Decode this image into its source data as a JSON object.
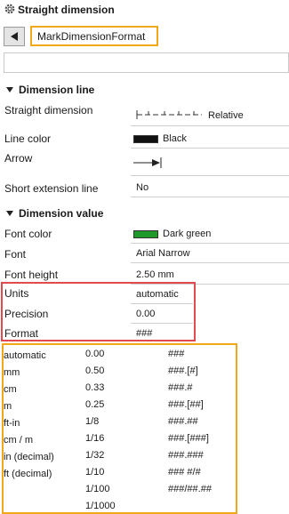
{
  "header": {
    "title": "Straight dimension",
    "format_field_value": "MarkDimensionFormat"
  },
  "sections": {
    "dimension_line": "Dimension line",
    "dimension_value": "Dimension value"
  },
  "properties": {
    "straight_dimension": {
      "label": "Straight dimension",
      "value": "Relative"
    },
    "line_color": {
      "label": "Line color",
      "value": "Black",
      "color": "#111111"
    },
    "arrow": {
      "label": "Arrow"
    },
    "short_extension_line": {
      "label": "Short extension line",
      "value": "No"
    },
    "font_color": {
      "label": "Font color",
      "value": "Dark green",
      "color": "#1f9a2a"
    },
    "font": {
      "label": "Font",
      "value": "Arial Narrow"
    },
    "font_height": {
      "label": "Font height",
      "value": "2.50 mm"
    },
    "units": {
      "label": "Units",
      "value": "automatic"
    },
    "precision": {
      "label": "Precision",
      "value": "0.00"
    },
    "format": {
      "label": "Format",
      "value": "###"
    }
  },
  "options": {
    "units": [
      "automatic",
      "mm",
      "cm",
      "m",
      "ft-in",
      "cm / m",
      "in (decimal)",
      "ft (decimal)"
    ],
    "precision": [
      "0.00",
      "0.50",
      "0.33",
      "0.25",
      "1/8",
      "1/16",
      "1/32",
      "1/10",
      "1/100",
      "1/1000"
    ],
    "format": [
      "###",
      "###.[#]",
      "###.#",
      "###.[##]",
      "###.##",
      "###.[###]",
      "###.###",
      "### #/#",
      "###/##.##"
    ]
  },
  "colors": {
    "highlight_orange": "#f0a818",
    "highlight_red": "#e34a50"
  }
}
